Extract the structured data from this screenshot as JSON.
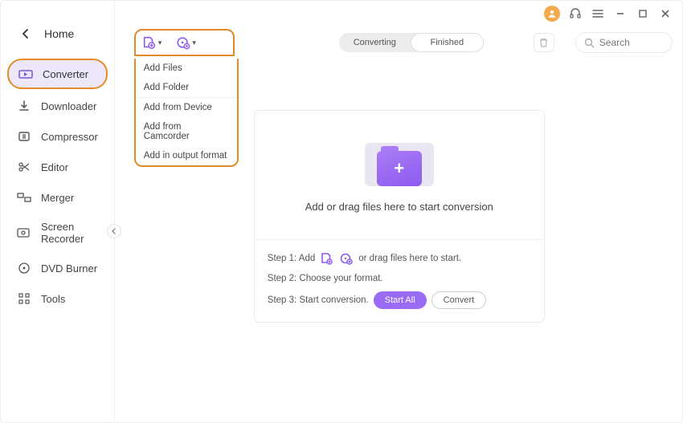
{
  "home_label": "Home",
  "sidebar": {
    "items": [
      {
        "label": "Converter"
      },
      {
        "label": "Downloader"
      },
      {
        "label": "Compressor"
      },
      {
        "label": "Editor"
      },
      {
        "label": "Merger"
      },
      {
        "label": "Screen Recorder"
      },
      {
        "label": "DVD Burner"
      },
      {
        "label": "Tools"
      }
    ]
  },
  "tabs": {
    "converting": "Converting",
    "finished": "Finished"
  },
  "search": {
    "placeholder": "Search"
  },
  "dropdown": {
    "items": [
      "Add Files",
      "Add Folder",
      "Add from Device",
      "Add from Camcorder",
      "Add in output format"
    ]
  },
  "drop": {
    "main_text": "Add or drag files here to start conversion"
  },
  "steps": {
    "s1_pre": "Step 1: Add",
    "s1_post": "or drag files here to start.",
    "s2": "Step 2: Choose your format.",
    "s3": "Step 3: Start conversion.",
    "start_all": "Start All",
    "convert": "Convert"
  },
  "colors": {
    "accent": "#9a6cf3",
    "highlight": "#e48a2a"
  }
}
